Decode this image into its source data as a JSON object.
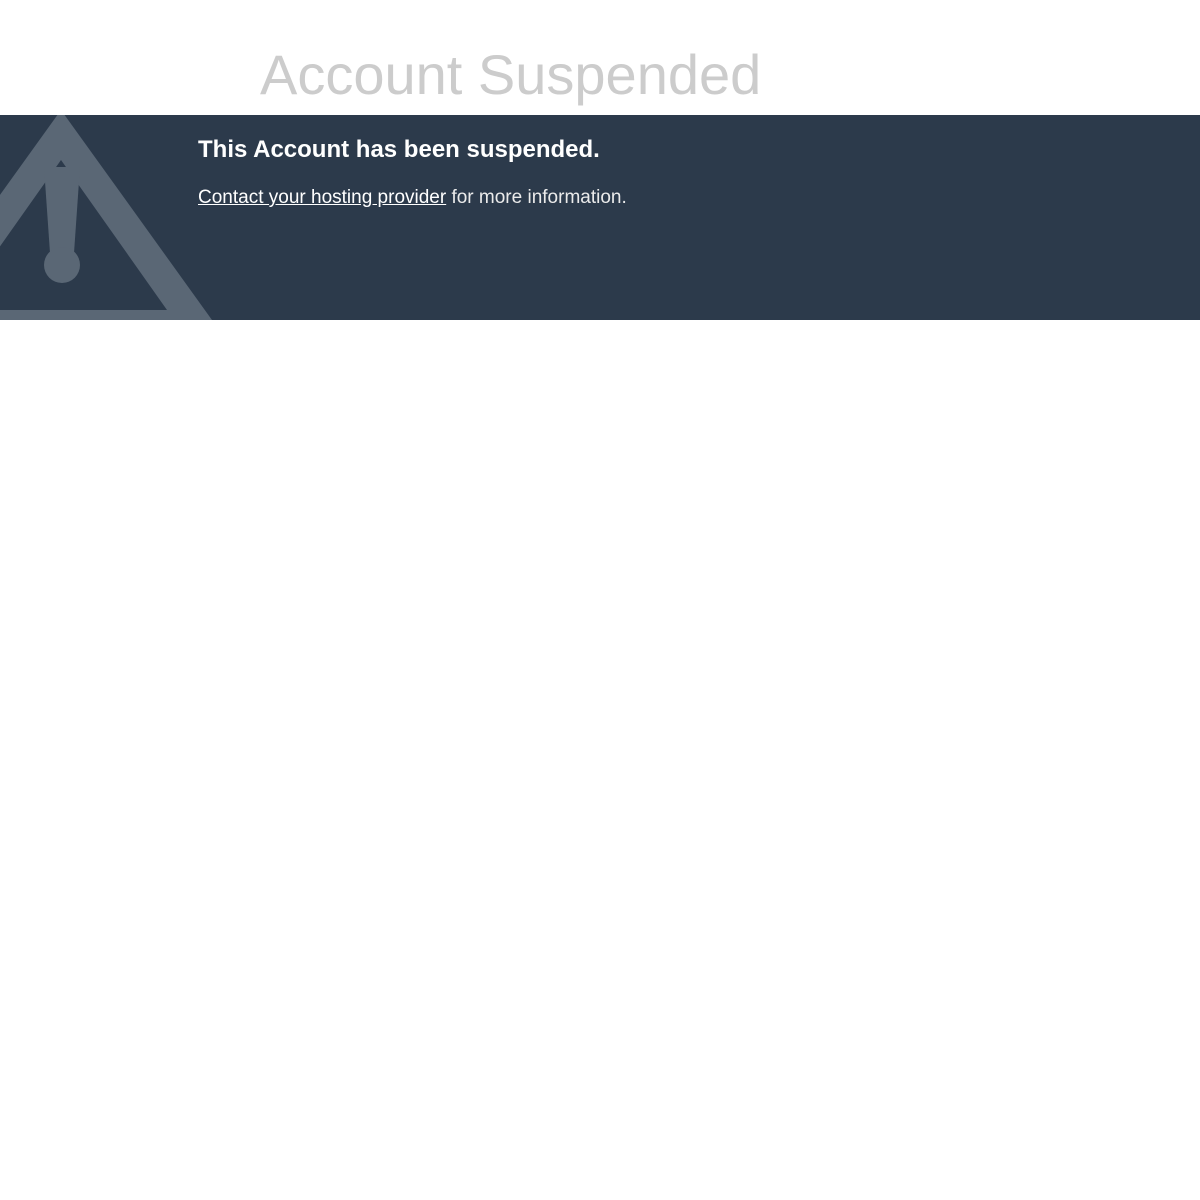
{
  "page": {
    "title": "Account Suspended"
  },
  "banner": {
    "headline": "This Account has been suspended.",
    "link_text": "Contact your hosting provider",
    "trailing_text": " for more information.",
    "icon": "warning-triangle-icon",
    "background_color": "#2c3a4b",
    "icon_color": "#5a6775"
  }
}
